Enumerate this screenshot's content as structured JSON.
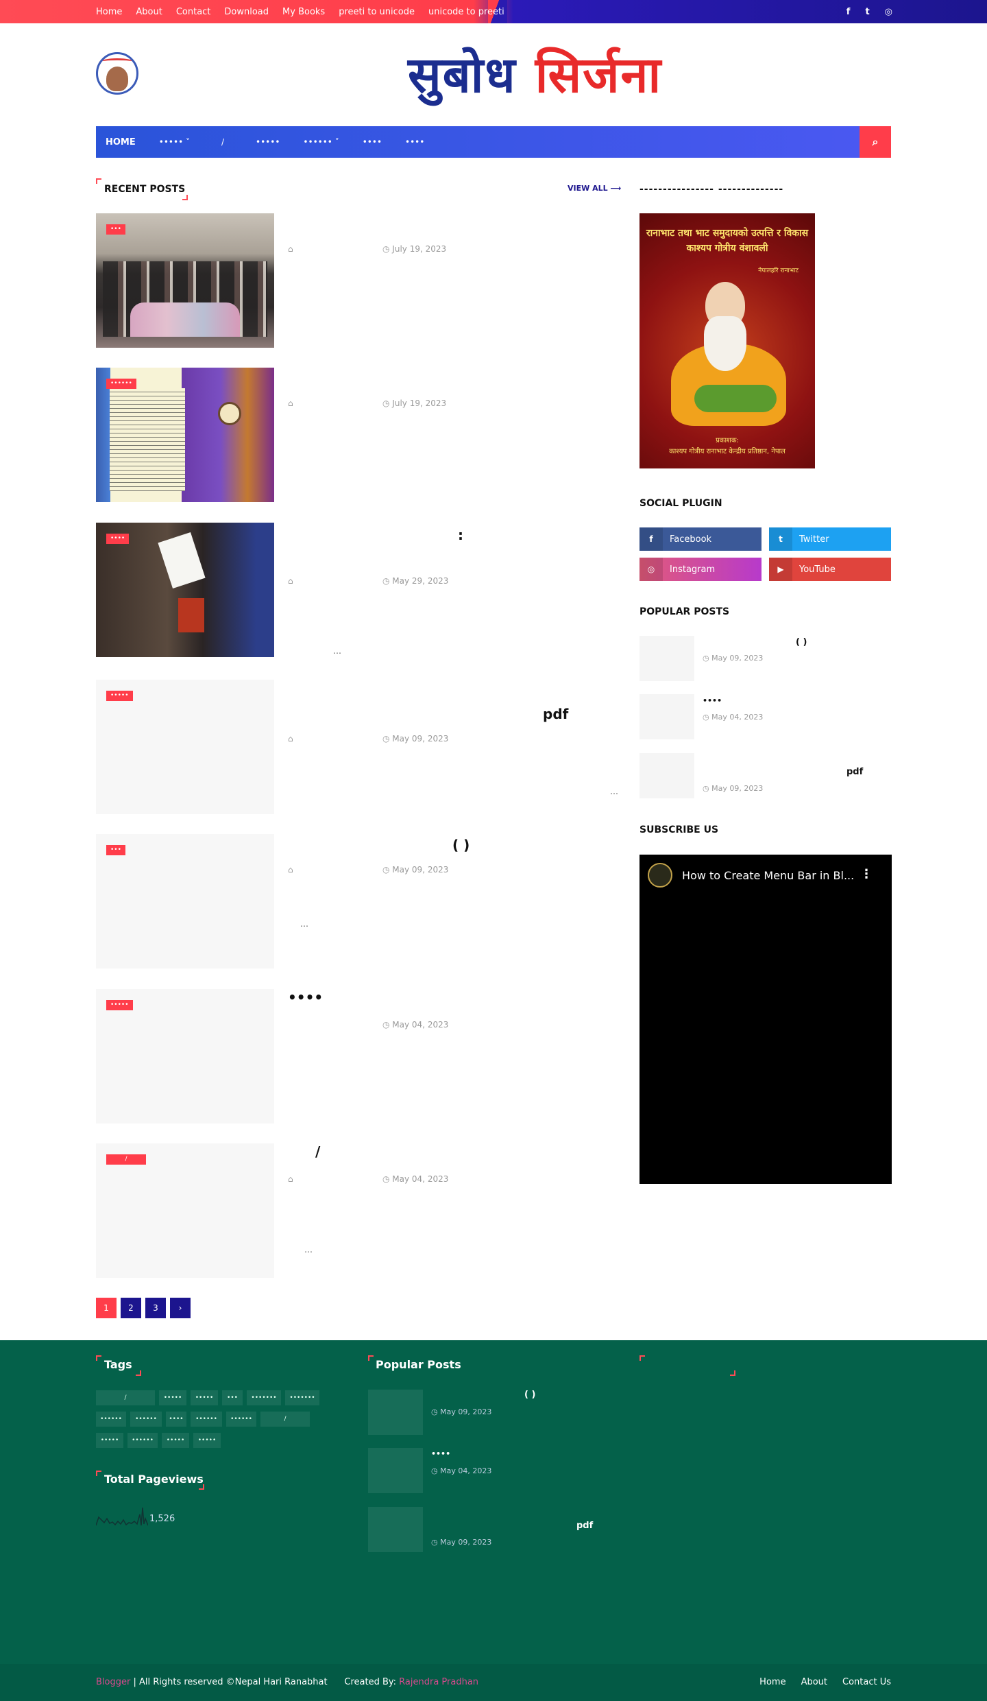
{
  "topbar": {
    "links": [
      "Home",
      "About",
      "Contact",
      "Download",
      "My Books",
      "preeti to unicode",
      "unicode to preeti"
    ],
    "social_icons": [
      "facebook-icon",
      "twitter-icon",
      "instagram-icon"
    ],
    "social_glyphs": [
      "f",
      "t",
      "◎"
    ]
  },
  "header": {
    "brand_part1": "सुबोध",
    "brand_part2": "सिर्जना"
  },
  "nav": {
    "home": "HOME",
    "items": [
      "••••• ˅",
      "/",
      "•••••",
      "•••••• ˅",
      "••••",
      "••••"
    ],
    "search_icon": "⌕"
  },
  "recent": {
    "heading": "RECENT POSTS",
    "view_all": "VIEW ALL ⟶"
  },
  "posts": [
    {
      "label": "•••",
      "title": "",
      "date": "July 19, 2023",
      "excerpt": ""
    },
    {
      "label": "••••••",
      "title": "",
      "date": "July 19, 2023",
      "excerpt": ""
    },
    {
      "label": "••••",
      "title": ":",
      "date": "May 29, 2023",
      "excerpt": "…"
    },
    {
      "label": "•••••",
      "title": "pdf",
      "date": "May 09, 2023",
      "excerpt": "…"
    },
    {
      "label": "•••",
      "title": "(          )",
      "date": "May 09, 2023",
      "excerpt": "…"
    },
    {
      "label": "•••••",
      "title": "••••",
      "date": "May 04, 2023",
      "excerpt": ""
    },
    {
      "label": "/",
      "title": "/",
      "date": "May 04, 2023",
      "excerpt": "…"
    }
  ],
  "pager": {
    "pages": [
      "1",
      "2",
      "3"
    ],
    "next": "›"
  },
  "sidebar": {
    "dash_title": "----------------                  --------------",
    "book": {
      "title_line1": "रानाभाट तथा भाट समुदायको उत्पत्ति र विकास",
      "title_line2": "काश्यप गोत्रीय वंशावली",
      "author": "नेपालहरि रानाभाट",
      "publisher_label": "प्रकाशक:",
      "publisher": "काश्यप गोत्रीय रानाभाट केन्द्रीय प्रतिष्ठान, नेपाल"
    },
    "social_heading": "SOCIAL PLUGIN",
    "social": [
      {
        "name": "Facebook",
        "icon": "f",
        "color": "#3b5998"
      },
      {
        "name": "Twitter",
        "icon": "t",
        "color": "#1da1f2"
      },
      {
        "name": "Instagram",
        "icon": "◎",
        "color": "#c13584"
      },
      {
        "name": "YouTube",
        "icon": "▶",
        "color": "#e0443d"
      }
    ],
    "popular_heading": "POPULAR POSTS",
    "popular": [
      {
        "title": "(          )",
        "date": "May 09, 2023"
      },
      {
        "title": "••••",
        "date": "May 04, 2023"
      },
      {
        "title": "pdf",
        "date": "May 09, 2023"
      }
    ],
    "subscribe_heading": "SUBSCRIBE US",
    "video_title": "How to Create Menu Bar in Bl...",
    "video_menu": "⋮"
  },
  "footer": {
    "tags_heading": "Tags",
    "tags": [
      "/",
      "•••••",
      "•••••",
      "•••",
      "•••••••",
      "•••••••",
      "••••••",
      "••••••",
      "••••",
      "••••••",
      "••••••",
      "/",
      "•••••",
      "••••••",
      "•••••",
      "•••••"
    ],
    "pageviews_heading": "Total Pageviews",
    "pageviews": "1,526",
    "popular_heading": "Popular Posts",
    "popular": [
      {
        "title": "(          )",
        "date": "May 09, 2023"
      },
      {
        "title": "••••",
        "date": "May 04, 2023"
      },
      {
        "title": "pdf",
        "date": "May 09, 2023"
      }
    ],
    "copyright_brand": "Blogger",
    "copyright_text": " | All Rights reserved ©Nepal Hari Ranabhat      Created By: ",
    "creator": "Rajendra Pradhan",
    "links": [
      "Home",
      "About",
      "Contact Us"
    ]
  },
  "colors": {
    "accent_red": "#ff3d4a",
    "nav_blue": "#2a54d9",
    "dark_blue": "#1c158e",
    "footer_green": "#04614a"
  }
}
